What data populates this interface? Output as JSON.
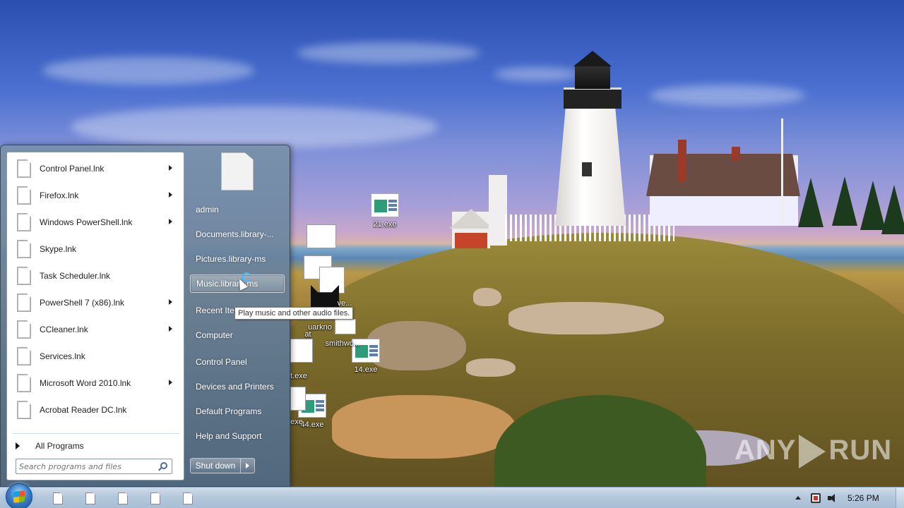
{
  "desktop": {
    "icons": [
      {
        "label": "21.exe"
      },
      {
        "label": "14.exe"
      },
      {
        "label": "44.exe"
      }
    ],
    "partial_labels": [
      "ve...",
      "uarkno",
      "at",
      "smithwc...",
      "t.exe",
      "exe"
    ]
  },
  "start_menu": {
    "programs": [
      {
        "label": "Control Panel.lnk",
        "has_submenu": true
      },
      {
        "label": "Firefox.lnk",
        "has_submenu": true
      },
      {
        "label": "Windows PowerShell.lnk",
        "has_submenu": true
      },
      {
        "label": "Skype.lnk",
        "has_submenu": false
      },
      {
        "label": "Task Scheduler.lnk",
        "has_submenu": false
      },
      {
        "label": "PowerShell 7 (x86).lnk",
        "has_submenu": true
      },
      {
        "label": "CCleaner.lnk",
        "has_submenu": true
      },
      {
        "label": "Services.lnk",
        "has_submenu": false
      },
      {
        "label": "Microsoft Word 2010.lnk",
        "has_submenu": true
      },
      {
        "label": "Acrobat Reader DC.lnk",
        "has_submenu": false
      }
    ],
    "all_programs_label": "All Programs",
    "search_placeholder": "Search programs and files",
    "right_items": [
      {
        "label": "admin"
      },
      {
        "label": "Documents.library-..."
      },
      {
        "label": "Pictures.library-ms"
      },
      {
        "label": "Music.library-ms",
        "hovered": true
      },
      {
        "label": "Recent Items"
      },
      {
        "label": "Computer"
      },
      {
        "label": "Control Panel"
      },
      {
        "label": "Devices and Printers"
      },
      {
        "label": "Default Programs"
      },
      {
        "label": "Help and Support"
      }
    ],
    "shutdown_label": "Shut down",
    "tooltip": "Play music and other audio files."
  },
  "taskbar": {
    "pinned_icons": [
      "file-icon",
      "file-icon",
      "file-icon",
      "file-icon",
      "file-icon"
    ],
    "clock": "5:26 PM"
  },
  "watermark": {
    "left": "ANY",
    "right": "RUN"
  },
  "colors": {
    "menu_accent": "#5a7896",
    "taskbar": "#b5c8dc",
    "sky": "#3a5fb5"
  }
}
